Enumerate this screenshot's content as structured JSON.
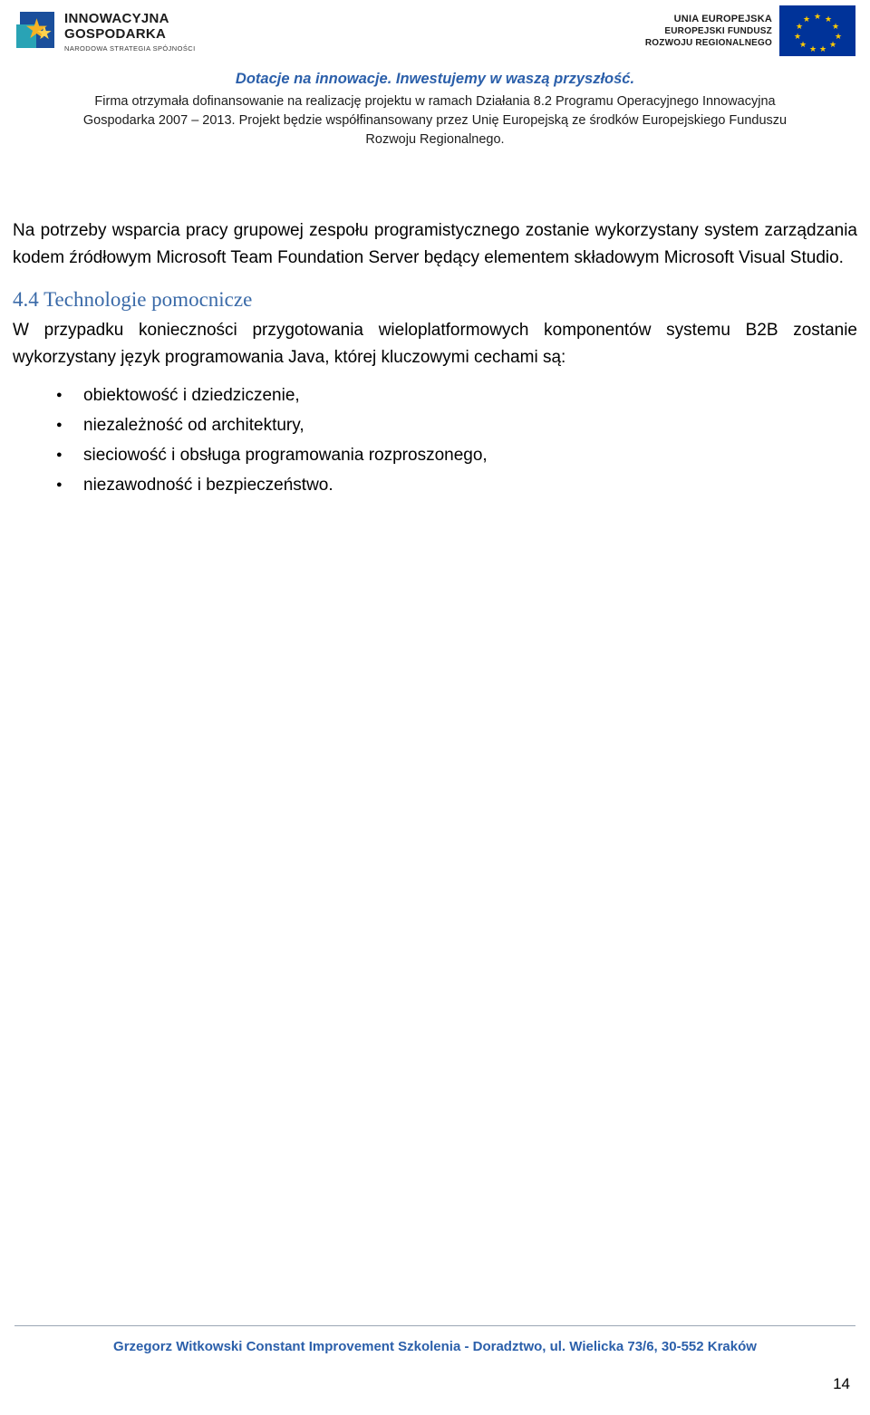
{
  "header": {
    "left_logo": {
      "line1": "INNOWACYJNA",
      "line2": "GOSPODARKA",
      "line3": "NARODOWA STRATEGIA SPÓJNOŚCI",
      "icon": "innowacyjna-gospodarka-logo"
    },
    "right_logo": {
      "line1": "UNIA EUROPEJSKA",
      "line2": "EUROPEJSKI FUNDUSZ",
      "line3": "ROZWOJU REGIONALNEGO",
      "icon": "eu-flag"
    }
  },
  "banner": {
    "tagline": "Dotacje na innowacje. Inwestujemy w waszą przyszłość.",
    "line1": "Firma otrzymała dofinansowanie na realizację projektu w ramach Działania 8.2 Programu Operacyjnego Innowacyjna",
    "line2": "Gospodarka 2007 – 2013. Projekt będzie współfinansowany przez Unię Europejską ze środków Europejskiego Funduszu",
    "line3": "Rozwoju Regionalnego."
  },
  "content": {
    "paragraph1": "Na potrzeby wsparcia pracy grupowej zespołu programistycznego zostanie wykorzystany system zarządzania kodem źródłowym Microsoft Team Foundation Server będący elementem składowym Microsoft Visual Studio.",
    "heading": "4.4  Technologie pomocnicze",
    "paragraph2": "W przypadku konieczności przygotowania wieloplatformowych komponentów systemu B2B zostanie wykorzystany język programowania Java, której kluczowymi cechami są:",
    "bullets": [
      "obiektowość i dziedziczenie,",
      "niezależność od architektury,",
      "sieciowość i obsługa programowania rozproszonego,",
      "niezawodność i bezpieczeństwo."
    ]
  },
  "footer": {
    "text": "Grzegorz Witkowski Constant Improvement Szkolenia - Doradztwo, ul. Wielicka 73/6, 30-552 Kraków",
    "page_number": "14"
  },
  "colors": {
    "accent_blue": "#2b5faa",
    "heading_blue": "#3a6aa8",
    "eu_blue": "#003399",
    "eu_yellow": "#ffcc00"
  }
}
